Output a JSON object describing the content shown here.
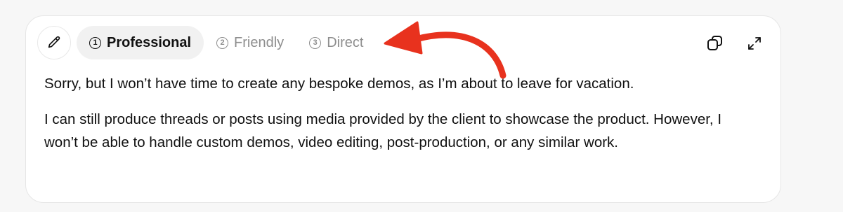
{
  "tabs": [
    {
      "number": "1",
      "label": "Professional",
      "active": true
    },
    {
      "number": "2",
      "label": "Friendly",
      "active": false
    },
    {
      "number": "3",
      "label": "Direct",
      "active": false
    }
  ],
  "icons": {
    "edit": "pencil-icon",
    "copy": "copy-icon",
    "expand": "expand-icon"
  },
  "content": {
    "paragraph_1": "Sorry, but I won’t have time to create any bespoke demos, as I’m about to leave for vacation.",
    "paragraph_2": "I can still produce threads or posts using media provided by the client to showcase the product. However, I won’t be able to handle custom demos, video editing, post-production, or any similar work."
  },
  "colors": {
    "arrow": "#e8321e",
    "active_tab_bg": "#f1f1f1",
    "inactive_text": "#8e8e8e"
  }
}
